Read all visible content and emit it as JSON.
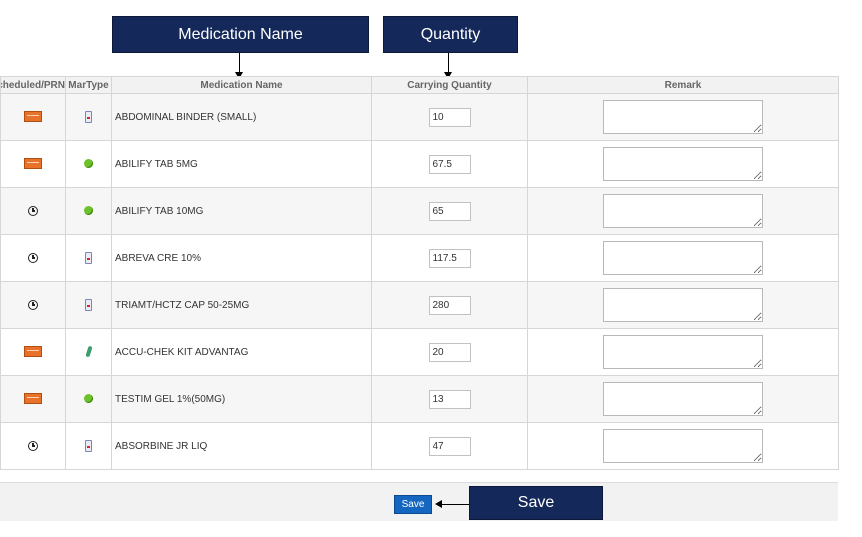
{
  "callouts": {
    "medication_name": "Medication Name",
    "quantity": "Quantity",
    "save": "Save"
  },
  "table": {
    "headers": [
      "Scheduled/PRN",
      "MarType",
      "Medication Name",
      "Carrying Quantity",
      "Remark"
    ],
    "rows": [
      {
        "schedule_icon": "prn-icon",
        "mar_icon": "bottle-icon",
        "name": "ABDOMINAL BINDER (SMALL)",
        "quantity": "10",
        "remark": ""
      },
      {
        "schedule_icon": "prn-icon",
        "mar_icon": "apple-icon",
        "name": "ABILIFY TAB 5MG",
        "quantity": "67.5",
        "remark": ""
      },
      {
        "schedule_icon": "clock-icon",
        "mar_icon": "apple-icon",
        "name": "ABILIFY TAB 10MG",
        "quantity": "65",
        "remark": ""
      },
      {
        "schedule_icon": "clock-icon",
        "mar_icon": "bottle-icon",
        "name": "ABREVA CRE 10%",
        "quantity": "117.5",
        "remark": ""
      },
      {
        "schedule_icon": "clock-icon",
        "mar_icon": "bottle-icon",
        "name": "TRIAMT/HCTZ CAP 50-25MG",
        "quantity": "280",
        "remark": ""
      },
      {
        "schedule_icon": "prn-icon",
        "mar_icon": "kit-icon",
        "name": "ACCU-CHEK KIT ADVANTAG",
        "quantity": "20",
        "remark": ""
      },
      {
        "schedule_icon": "prn-icon",
        "mar_icon": "apple-icon",
        "name": "TESTIM GEL 1%(50MG)",
        "quantity": "13",
        "remark": ""
      },
      {
        "schedule_icon": "clock-icon",
        "mar_icon": "bottle-icon",
        "name": "ABSORBINE JR LIQ",
        "quantity": "47",
        "remark": ""
      }
    ]
  },
  "footer": {
    "save_label": "Save"
  },
  "colors": {
    "callout_bg": "#14285a",
    "save_button": "#1566c0",
    "prn_orange": "#e8722a"
  }
}
